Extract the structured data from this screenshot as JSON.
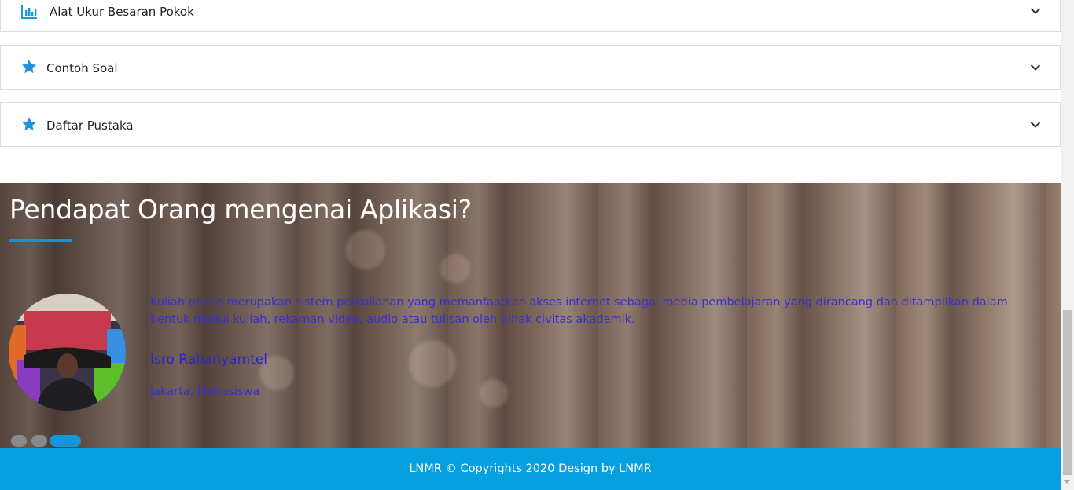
{
  "accordion": {
    "items": [
      {
        "label": "Alat Ukur Besaran Pokok",
        "icon": "bar-chart-icon"
      },
      {
        "label": "Contoh Soal",
        "icon": "star-icon"
      },
      {
        "label": "Daftar Pustaka",
        "icon": "star-icon"
      }
    ]
  },
  "testimonial": {
    "title": "Pendapat Orang mengenai Aplikasi?",
    "quote": "Kuliah online merupakan sistem perkuliahan yang memanfaatkan akses internet sebagai media pembelajaran yang dirancang dan ditampilkan dalam bentuk modul kuliah, rekaman video, audio atau tulisan oleh pihak civitas akademik.",
    "name": "Isro Rahanyamtel",
    "meta": "Jakarta, Mahasiswa",
    "slides_total": 3,
    "active_slide": 3
  },
  "footer": {
    "text": "LNMR © Copyrights 2020 Design by LNMR"
  },
  "colors": {
    "accent": "#069fe0",
    "icon_blue": "#1e95d8",
    "testimonial_text": "#3a2fd6"
  }
}
